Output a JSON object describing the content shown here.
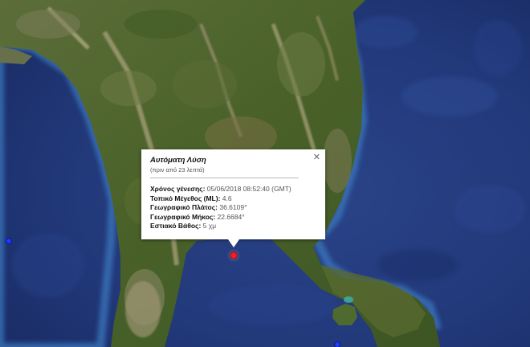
{
  "popup": {
    "title": "Αυτόματη Λύση",
    "subtitle": "(πριν από 23 λεπτά)",
    "close_icon": "close-icon",
    "fields": [
      {
        "label": "Χρόνος γένεσης:",
        "value": "05/06/2018  08:52:40 (GMT)"
      },
      {
        "label": "Τοπικό Μέγεθος (ML):",
        "value": "4.6"
      },
      {
        "label": "Γεωγραφικό Πλάτος:",
        "value": "36.6109°"
      },
      {
        "label": "Γεωγραφικό Μήκος:",
        "value": "22.6684°"
      },
      {
        "label": "Εστιακό Βάθος:",
        "value": "5 χμ"
      }
    ]
  },
  "markers": {
    "epicenter_color": "#e8202a",
    "other_color": "#1c3cff"
  },
  "colors": {
    "sea": "#22397a",
    "sea_deep": "#1a2c66",
    "land_green": "#4f6a2e",
    "land_dark": "#3b5224",
    "land_light": "#8a8a62",
    "coast": "#3b78b8"
  }
}
